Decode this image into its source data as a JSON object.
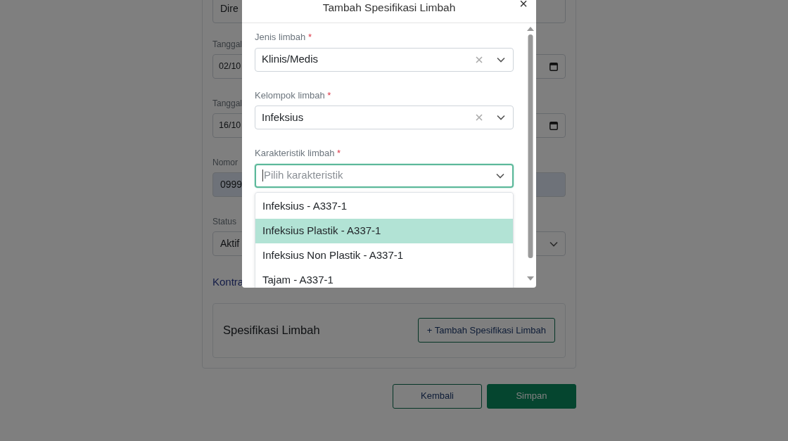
{
  "page_form": {
    "fields": [
      {
        "kind": "text",
        "value": "Dire"
      },
      {
        "kind": "date",
        "label": "Tanggal",
        "value": "02/10"
      },
      {
        "kind": "date",
        "label": "Tanggal",
        "value": "16/10"
      },
      {
        "kind": "readonly",
        "label": "Nomor",
        "value": "0999"
      },
      {
        "kind": "select",
        "label": "Status",
        "value": "Aktif"
      }
    ],
    "link": "Kontra",
    "spec_section": {
      "title": "Spesifikasi Limbah",
      "add_button": "+ Tambah Spesifikasi Limbah"
    }
  },
  "actions": {
    "back": "Kembali",
    "save": "Simpan"
  },
  "modal": {
    "title": "Tambah Spesifikasi Limbah",
    "close": "×",
    "fields": [
      {
        "label": "Jenis limbah",
        "required_mark": "*",
        "value": "Klinis/Medis",
        "clearable": true,
        "focused": false
      },
      {
        "label": "Kelompok limbah",
        "required_mark": "*",
        "value": "Infeksius",
        "clearable": true,
        "focused": false
      },
      {
        "label": "Karakteristik limbah",
        "required_mark": "*",
        "placeholder": "Pilih karakteristik",
        "clearable": false,
        "focused": true
      }
    ],
    "options": [
      {
        "label": "Infeksius - A337-1",
        "selected": false
      },
      {
        "label": "Infeksius Plastik - A337-1",
        "selected": true
      },
      {
        "label": "Infeksius Non Plastik - A337-1",
        "selected": false
      },
      {
        "label": "Tajam - A337-1",
        "selected": false
      }
    ]
  }
}
